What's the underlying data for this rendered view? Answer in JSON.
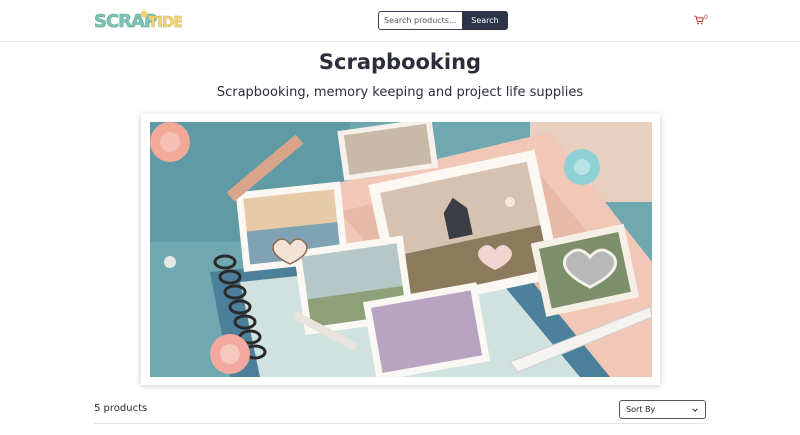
{
  "header": {
    "logo_text": "SCRAPTIDE",
    "search": {
      "placeholder": "Search products...",
      "button_label": "Search"
    },
    "cart": {
      "count": "0",
      "icon": "cart-icon"
    }
  },
  "page": {
    "title": "Scrapbooking",
    "subtitle": "Scrapbooking, memory keeping and project life supplies"
  },
  "listing": {
    "product_count": "5 products",
    "sort": {
      "selected": "Sort By"
    }
  },
  "colors": {
    "primary": "#2d3448",
    "cart": "#c0392b",
    "logo_teal": "#7fc3b3",
    "logo_yellow": "#f0d47a"
  }
}
